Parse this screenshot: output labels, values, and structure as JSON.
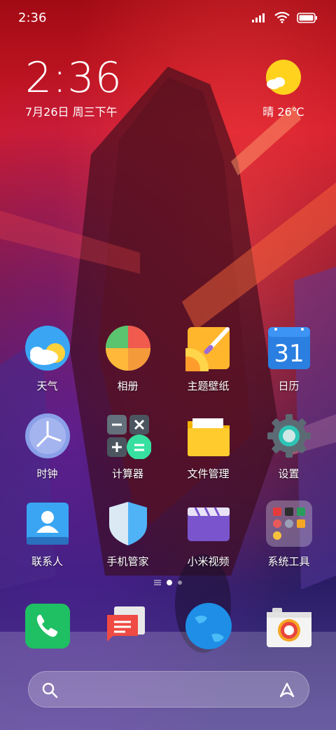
{
  "status_bar": {
    "time": "2:36"
  },
  "clock": {
    "time": "2:36",
    "date": "7月26日 周三下午"
  },
  "weather": {
    "text": "晴 26℃"
  },
  "apps": [
    {
      "label": "天气",
      "icon": "weather-icon"
    },
    {
      "label": "相册",
      "icon": "gallery-icon"
    },
    {
      "label": "主题壁纸",
      "icon": "themes-icon"
    },
    {
      "label": "日历",
      "icon": "calendar-icon",
      "date_number": "31"
    },
    {
      "label": "时钟",
      "icon": "clock-icon"
    },
    {
      "label": "计算器",
      "icon": "calculator-icon"
    },
    {
      "label": "文件管理",
      "icon": "file-manager-icon"
    },
    {
      "label": "设置",
      "icon": "settings-icon"
    },
    {
      "label": "联系人",
      "icon": "contacts-icon"
    },
    {
      "label": "手机管家",
      "icon": "security-icon"
    },
    {
      "label": "小米视频",
      "icon": "video-icon"
    },
    {
      "label": "系统工具",
      "icon": "folder-icon"
    }
  ],
  "dock": [
    {
      "icon": "phone-icon"
    },
    {
      "icon": "messages-icon"
    },
    {
      "icon": "browser-icon"
    },
    {
      "icon": "camera-icon"
    }
  ],
  "page_indicator": {
    "pages": 2,
    "current": 1
  },
  "colors": {
    "dock_bg": "#ffffff2e",
    "accent_blue": "#2b7de9"
  }
}
